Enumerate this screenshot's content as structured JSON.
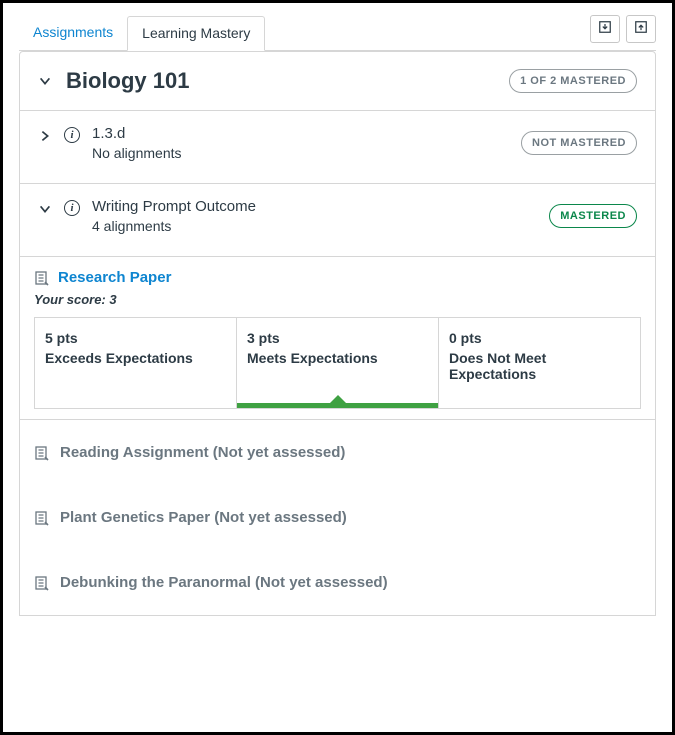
{
  "tabs": {
    "assignments": "Assignments",
    "learning_mastery": "Learning Mastery"
  },
  "course": {
    "title": "Biology 101",
    "mastery_summary": "1 OF 2 MASTERED"
  },
  "outcomes": [
    {
      "title": "1.3.d",
      "sub": "No alignments",
      "badge": "NOT MASTERED",
      "expanded": false
    },
    {
      "title": "Writing Prompt Outcome",
      "sub": "4 alignments",
      "badge": "MASTERED",
      "expanded": true
    }
  ],
  "alignment": {
    "link": "Research Paper",
    "score_label": "Your score:",
    "score_value": "3",
    "rubric": [
      {
        "pts": "5 pts",
        "label": "Exceeds Expectations",
        "current": false
      },
      {
        "pts": "3 pts",
        "label": "Meets Expectations",
        "current": true
      },
      {
        "pts": "0 pts",
        "label": "Does Not Meet Expectations",
        "current": false
      }
    ]
  },
  "pending": [
    "Reading Assignment (Not yet assessed)",
    "Plant Genetics Paper (Not yet assessed)",
    "Debunking the Paranormal (Not yet assessed)"
  ]
}
